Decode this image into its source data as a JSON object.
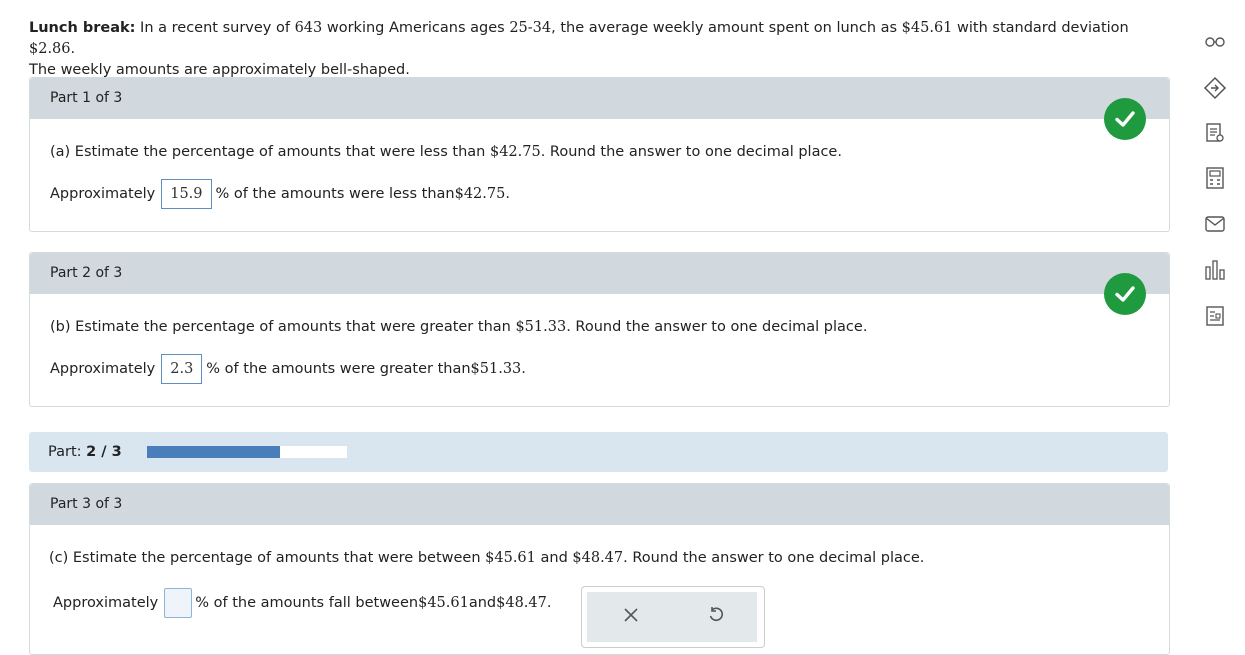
{
  "problem": {
    "title": "Lunch break:",
    "text_a": " In a recent survey of ",
    "n": "643",
    "text_b": " working Americans ages ",
    "ages": "25-34",
    "text_c": ", the average weekly amount spent on lunch as ",
    "mean": "$45.61",
    "text_d": " with standard deviation ",
    "sd": "$2.86",
    "text_e": ".",
    "line2": "The weekly amounts are approximately bell-shaped."
  },
  "parts": [
    {
      "header": "Part 1 of 3",
      "question_a": "(a) Estimate the percentage of amounts that were less than ",
      "question_val": "$42.75",
      "question_b": ". Round the answer to one decimal place.",
      "answer_prefix": "Approximately",
      "answer_value": "15.9",
      "answer_suffix_a": "% of the amounts were less than ",
      "answer_suffix_val": "$42.75",
      "answer_suffix_b": ".",
      "status": "correct"
    },
    {
      "header": "Part 2 of 3",
      "question_a": "(b) Estimate the percentage of amounts that were greater than ",
      "question_val": "$51.33",
      "question_b": ". Round the answer to one decimal place.",
      "answer_prefix": "Approximately",
      "answer_value": "2.3",
      "answer_suffix_a": "% of the amounts were greater than ",
      "answer_suffix_val": "$51.33",
      "answer_suffix_b": ".",
      "status": "correct"
    },
    {
      "header": "Part 3 of 3",
      "question_a": "(c) Estimate the percentage of amounts that were between ",
      "question_val1": "$45.61",
      "question_and": " and ",
      "question_val2": "$48.47",
      "question_b": ". Round the answer to one decimal place.",
      "answer_prefix": "Approximately",
      "answer_value": "",
      "answer_suffix_a": "% of the amounts fall between ",
      "answer_suffix_val1": "$45.61",
      "answer_suffix_and": " and ",
      "answer_suffix_val2": "$48.47",
      "answer_suffix_b": "."
    }
  ],
  "progress": {
    "label": "Part: ",
    "current": "2 / 3",
    "fraction": 0.667
  },
  "tools": {
    "clear_icon": "close-icon",
    "undo_icon": "undo-icon"
  },
  "sidebar_icons": [
    "glasses-icon",
    "tag-icon",
    "notes-icon",
    "calculator-icon",
    "mail-icon",
    "chart-icon",
    "table-icon"
  ],
  "colors": {
    "correct": "#1f9a3e",
    "progress_fill": "#4a7ebb",
    "header_bg": "#d1d9de",
    "progress_bg": "#d9e6f0"
  }
}
